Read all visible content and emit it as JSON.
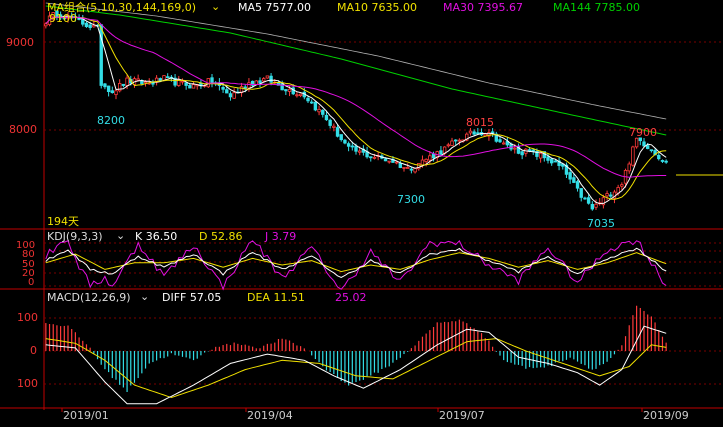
{
  "colors": {
    "bg": "#000000",
    "axis": "#c00000",
    "grid": "#7a0000",
    "up": "#ff3b3b",
    "down": "#33dde6",
    "ma5": "#ffffff",
    "ma10": "#f0e000",
    "ma30": "#e010e0",
    "ma144": "#00d000",
    "ma169": "#b0b0b0",
    "kdj_k": "#ffffff",
    "kdj_d": "#f0e000",
    "kdj_j": "#e010e0",
    "macd_diff": "#ffffff",
    "macd_dea": "#f0e000",
    "label_cyan": "#33dde6",
    "label_red": "#ff4040",
    "label_yellow": "#f0e000"
  },
  "main_legend": {
    "name": "MA组合(5,10,30,144,169,0)",
    "ma5": "MA5  7577.00",
    "ma10": "MA10  7635.00",
    "ma30": "MA30  7395.67",
    "ma144": "MA144  7785.00",
    "top_price": "9100"
  },
  "price_axis": {
    "tick_9000": "9000",
    "tick_8000": "8000"
  },
  "annotations": {
    "a8200": "8200",
    "a7300": "7300",
    "a8015": "8015",
    "a7900": "7900",
    "a7035": "7035"
  },
  "days_label": "194天",
  "kdj": {
    "name": "KDJ(9,3,3)",
    "k": "K  36.50",
    "d": "D  52.86",
    "j": "J  3.79",
    "ticks": [
      "100",
      "80",
      "50",
      "20",
      "0"
    ]
  },
  "macd": {
    "name": "MACD(12,26,9)",
    "diff": "DIFF  57.05",
    "dea": "DEA  11.51",
    "macd": "25.02",
    "ticks": [
      "100",
      "0",
      "100"
    ]
  },
  "dates": [
    "2019/01",
    "2019/04",
    "2019/07",
    "2019/09"
  ],
  "chart_data": {
    "type": "candlestick",
    "price_range": [
      6950,
      9200
    ],
    "key_levels": [
      {
        "label": "9100",
        "index": 3,
        "value": 9100
      },
      {
        "label": "8200",
        "index": 17,
        "value": 8200
      },
      {
        "label": "7300",
        "index": 99,
        "value": 7300
      },
      {
        "label": "8015",
        "index": 120,
        "value": 8015
      },
      {
        "label": "7035",
        "index": 148,
        "value": 7035
      },
      {
        "label": "7900",
        "index": 162,
        "value": 7900
      }
    ],
    "close_anchors": [
      [
        0,
        9000
      ],
      [
        3,
        9080
      ],
      [
        8,
        9010
      ],
      [
        14,
        8920
      ],
      [
        15,
        8380
      ],
      [
        18,
        8300
      ],
      [
        22,
        8400
      ],
      [
        28,
        8380
      ],
      [
        32,
        8420
      ],
      [
        36,
        8380
      ],
      [
        40,
        8350
      ],
      [
        45,
        8400
      ],
      [
        50,
        8250
      ],
      [
        55,
        8380
      ],
      [
        60,
        8420
      ],
      [
        64,
        8340
      ],
      [
        70,
        8260
      ],
      [
        76,
        8020
      ],
      [
        82,
        7720
      ],
      [
        88,
        7650
      ],
      [
        94,
        7600
      ],
      [
        98,
        7520
      ],
      [
        102,
        7600
      ],
      [
        108,
        7720
      ],
      [
        112,
        7820
      ],
      [
        116,
        7880
      ],
      [
        120,
        7900
      ],
      [
        124,
        7760
      ],
      [
        128,
        7700
      ],
      [
        132,
        7680
      ],
      [
        136,
        7620
      ],
      [
        140,
        7520
      ],
      [
        144,
        7300
      ],
      [
        148,
        7120
      ],
      [
        152,
        7250
      ],
      [
        156,
        7380
      ],
      [
        160,
        7820
      ],
      [
        162,
        7780
      ],
      [
        164,
        7720
      ],
      [
        166,
        7650
      ],
      [
        168,
        7580
      ]
    ],
    "ma_anchors": {
      "ma144": [
        [
          0,
          9150
        ],
        [
          20,
          9060
        ],
        [
          50,
          8880
        ],
        [
          80,
          8620
        ],
        [
          110,
          8320
        ],
        [
          140,
          8080
        ],
        [
          168,
          7860
        ]
      ],
      "ma169": [
        [
          0,
          9180
        ],
        [
          30,
          9050
        ],
        [
          60,
          8870
        ],
        [
          90,
          8650
        ],
        [
          120,
          8380
        ],
        [
          150,
          8150
        ],
        [
          168,
          8020
        ]
      ]
    },
    "kdj_anchors": {
      "k": [
        [
          0,
          60
        ],
        [
          6,
          85
        ],
        [
          12,
          40
        ],
        [
          18,
          30
        ],
        [
          25,
          70
        ],
        [
          32,
          45
        ],
        [
          40,
          75
        ],
        [
          48,
          30
        ],
        [
          56,
          80
        ],
        [
          64,
          40
        ],
        [
          72,
          70
        ],
        [
          80,
          20
        ],
        [
          88,
          60
        ],
        [
          96,
          30
        ],
        [
          104,
          75
        ],
        [
          112,
          85
        ],
        [
          120,
          60
        ],
        [
          128,
          35
        ],
        [
          136,
          70
        ],
        [
          144,
          30
        ],
        [
          152,
          65
        ],
        [
          160,
          88
        ],
        [
          168,
          36.5
        ]
      ],
      "d": [
        [
          0,
          55
        ],
        [
          8,
          75
        ],
        [
          16,
          40
        ],
        [
          24,
          55
        ],
        [
          32,
          55
        ],
        [
          40,
          65
        ],
        [
          48,
          45
        ],
        [
          56,
          65
        ],
        [
          64,
          50
        ],
        [
          72,
          60
        ],
        [
          80,
          35
        ],
        [
          88,
          50
        ],
        [
          96,
          40
        ],
        [
          104,
          62
        ],
        [
          112,
          78
        ],
        [
          120,
          65
        ],
        [
          128,
          45
        ],
        [
          136,
          60
        ],
        [
          144,
          40
        ],
        [
          152,
          55
        ],
        [
          160,
          78
        ],
        [
          168,
          52.86
        ]
      ]
    },
    "macd_anchors": {
      "hist": [
        [
          0,
          90
        ],
        [
          6,
          80
        ],
        [
          12,
          10
        ],
        [
          16,
          -60
        ],
        [
          22,
          -130
        ],
        [
          28,
          -40
        ],
        [
          34,
          -10
        ],
        [
          40,
          -30
        ],
        [
          46,
          15
        ],
        [
          52,
          25
        ],
        [
          58,
          10
        ],
        [
          64,
          40
        ],
        [
          70,
          10
        ],
        [
          76,
          -60
        ],
        [
          82,
          -110
        ],
        [
          88,
          -80
        ],
        [
          94,
          -40
        ],
        [
          100,
          20
        ],
        [
          106,
          90
        ],
        [
          112,
          100
        ],
        [
          118,
          60
        ],
        [
          124,
          -30
        ],
        [
          130,
          -55
        ],
        [
          136,
          -50
        ],
        [
          142,
          -20
        ],
        [
          148,
          -60
        ],
        [
          152,
          -35
        ],
        [
          156,
          15
        ],
        [
          160,
          145
        ],
        [
          164,
          110
        ],
        [
          168,
          25
        ]
      ],
      "diff": [
        [
          0,
          20
        ],
        [
          8,
          10
        ],
        [
          16,
          -100
        ],
        [
          22,
          -170
        ],
        [
          30,
          -170
        ],
        [
          40,
          -110
        ],
        [
          50,
          -40
        ],
        [
          60,
          -10
        ],
        [
          70,
          -30
        ],
        [
          78,
          -80
        ],
        [
          86,
          -120
        ],
        [
          96,
          -60
        ],
        [
          106,
          20
        ],
        [
          114,
          70
        ],
        [
          120,
          60
        ],
        [
          128,
          -20
        ],
        [
          136,
          -40
        ],
        [
          144,
          -70
        ],
        [
          150,
          -110
        ],
        [
          156,
          -60
        ],
        [
          162,
          80
        ],
        [
          168,
          57.05
        ]
      ],
      "dea": [
        [
          0,
          40
        ],
        [
          8,
          25
        ],
        [
          16,
          -30
        ],
        [
          24,
          -110
        ],
        [
          34,
          -150
        ],
        [
          44,
          -110
        ],
        [
          54,
          -60
        ],
        [
          64,
          -30
        ],
        [
          74,
          -40
        ],
        [
          84,
          -80
        ],
        [
          94,
          -90
        ],
        [
          104,
          -30
        ],
        [
          114,
          30
        ],
        [
          122,
          40
        ],
        [
          130,
          0
        ],
        [
          140,
          -40
        ],
        [
          150,
          -80
        ],
        [
          158,
          -50
        ],
        [
          164,
          20
        ],
        [
          168,
          11.51
        ]
      ]
    }
  }
}
